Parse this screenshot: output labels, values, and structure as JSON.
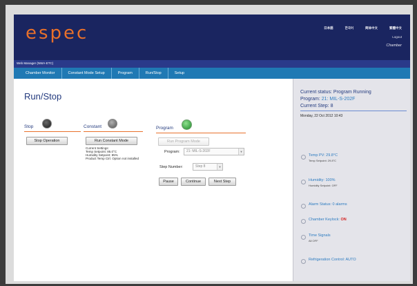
{
  "brand": {
    "logo": "espec"
  },
  "header": {
    "languages": [
      "日本語",
      "한국어",
      "简体中文",
      "繁體中文"
    ],
    "logout": "Logout",
    "chamber_name": "Chamber"
  },
  "subbar": {
    "text": "Web Manager (NWA-ETC)"
  },
  "nav": {
    "tabs": [
      "Chamber Monitor",
      "Constant Mode Setup",
      "Program",
      "Run/Stop",
      "Setup"
    ]
  },
  "page": {
    "title": "Run/Stop"
  },
  "stop": {
    "label": "Stop",
    "button": "Stop Operation",
    "lamp_color": "#3a3a3a"
  },
  "constant": {
    "label": "Constant",
    "button": "Run Constant Mode",
    "settings_title": "Current Settings:",
    "settings": [
      "Temp Setpoint: 85.0°C",
      "Humidity Setpoint: 85%",
      "Product Temp Ctrl. Option not installed"
    ],
    "lamp_color": "#7a7a7a"
  },
  "program": {
    "label": "Program",
    "run_button": "Run Program Mode",
    "program_label": "Program:",
    "program_value": "21: MIL-S-202F",
    "step_label": "Step Number:",
    "step_value": "Step 8",
    "pause": "Pause",
    "continue": "Continue",
    "next_step": "Next Step",
    "lamp_color": "#2fa23a"
  },
  "sidebar": {
    "status_label": "Current status:",
    "status_value": "Program Running",
    "program_label": "Program:",
    "program_value": "21: MIL-S-202F",
    "step_label": "Current Step:",
    "step_value": "8",
    "date": "Monday, 22 Oct 2012 10:43",
    "items": [
      {
        "title": "Temp PV: 29.8°C",
        "sub": "Temp Setpoint: 29.8°C"
      },
      {
        "title": "Humidity: 100%",
        "sub": "Humidity Setpoint: OFF"
      },
      {
        "title": "Alarm Status: 0 alarms",
        "sub": ""
      },
      {
        "title": "Chamber Keylock:",
        "flag": "ON",
        "sub": ""
      },
      {
        "title": "Time Signals",
        "sub": "All OFF"
      },
      {
        "title": "Refrigeration Control: AUTO",
        "sub": ""
      }
    ]
  },
  "colors": {
    "accent": "#e8702a",
    "header": "#1a2560",
    "nav": "#1f79b4",
    "title": "#233a7e"
  }
}
